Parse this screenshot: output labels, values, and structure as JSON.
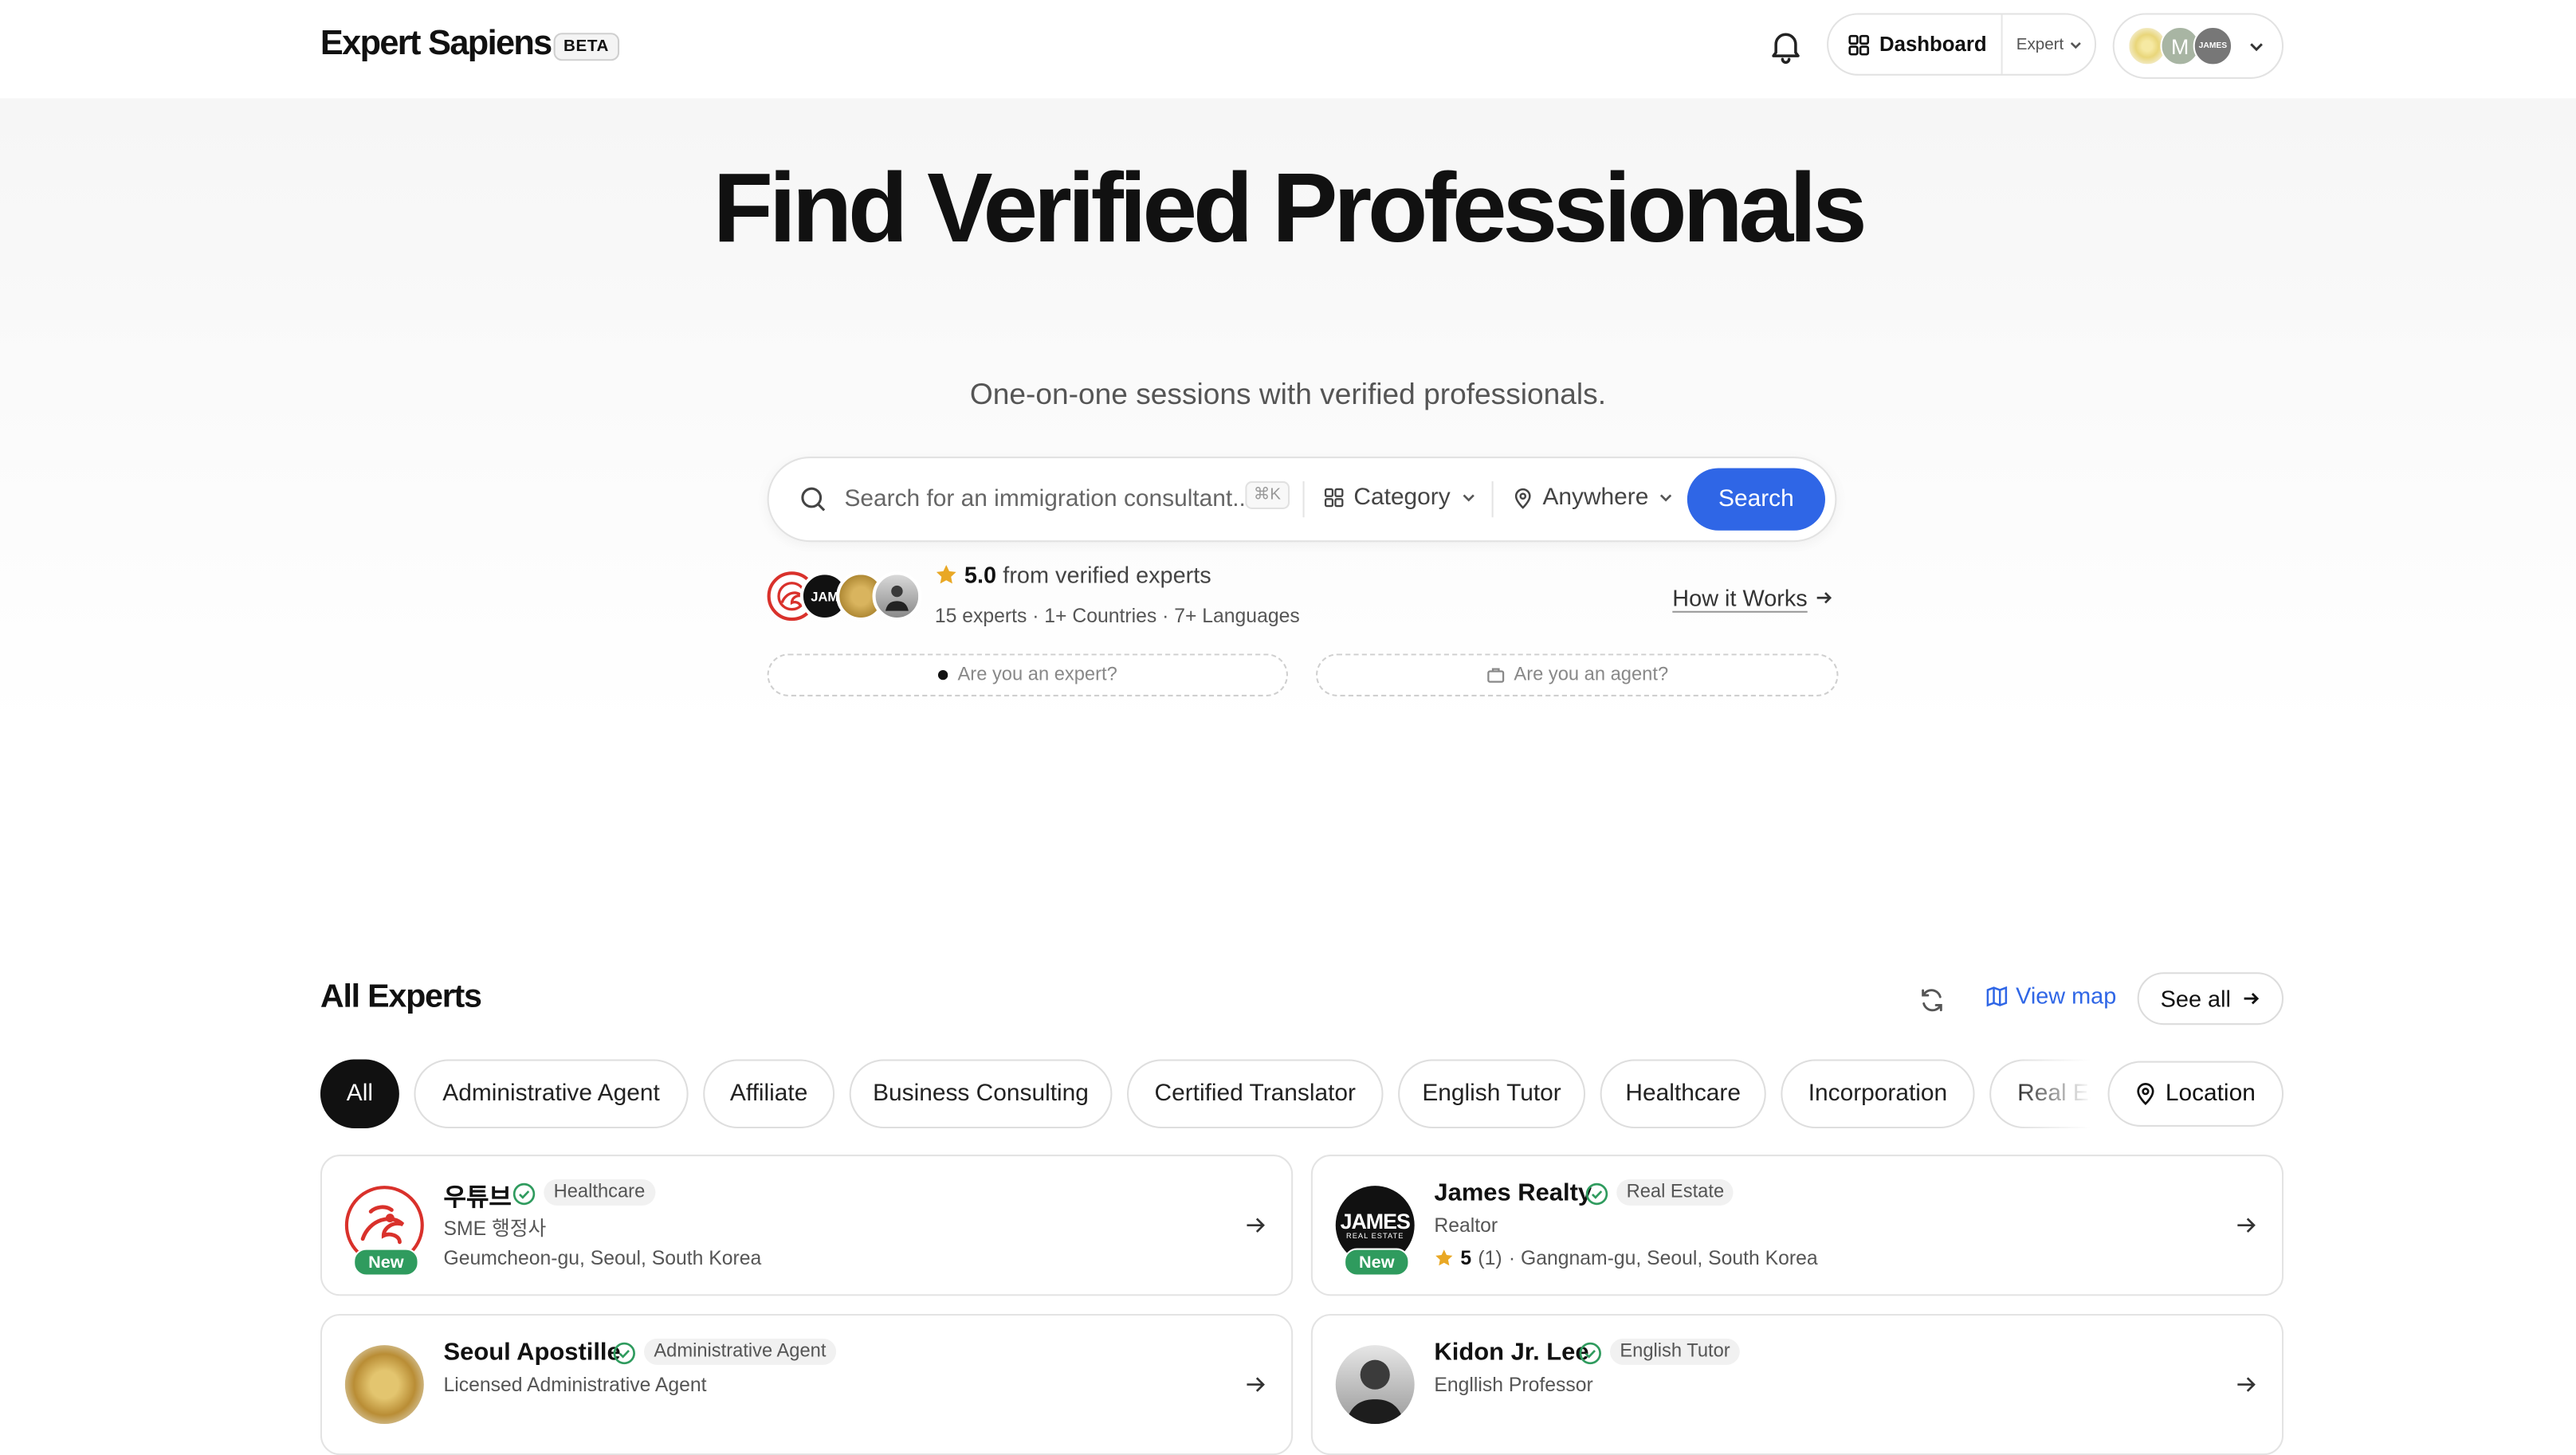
{
  "header": {
    "brand": "Expert Sapiens",
    "badge": "BETA",
    "dashboard_label": "Dashboard",
    "role_label": "Expert",
    "avatar_m": "M",
    "avatar_james": "JAMES"
  },
  "hero": {
    "title": "Find Verified Professionals",
    "subtitle": "One-on-one sessions with verified professionals.",
    "search_placeholder": "Search for an immigration consultant...",
    "shortcut": "⌘K",
    "category_label": "Category",
    "location_label": "Anywhere",
    "search_button": "Search",
    "rating_value": "5.0",
    "rating_text": "from verified experts",
    "stats": "15 experts · 1+ Countries · 7+ Languages",
    "how_it_works": "How it Works",
    "cta_expert": "Are you an expert?",
    "cta_agent": "Are you an agent?",
    "proof_james": "JAM"
  },
  "experts": {
    "title": "All Experts",
    "view_map": "View map",
    "see_all": "See all",
    "location_filter": "Location",
    "categories": [
      "All",
      "Administrative Agent",
      "Affiliate",
      "Business Consulting",
      "Certified Translator",
      "English Tutor",
      "Healthcare",
      "Incorporation",
      "Real Estate"
    ],
    "new_label": "New",
    "cards": [
      {
        "name": "우튜브",
        "tag": "Healthcare",
        "subtitle": "SME 행정사",
        "location": "Geumcheon-gu, Seoul, South Korea"
      },
      {
        "name": "James Realty",
        "tag": "Real Estate",
        "subtitle": "Realtor",
        "rating": "5",
        "reviews": "(1)",
        "location": "· Gangnam-gu, Seoul, South Korea",
        "logo_text": "JAMES",
        "logo_sub": "REAL ESTATE"
      },
      {
        "name": "Seoul Apostille",
        "tag": "Administrative Agent",
        "subtitle": "Licensed Administrative Agent"
      },
      {
        "name": "Kidon Jr. Lee",
        "tag": "English Tutor",
        "subtitle": "Engllish Professor"
      }
    ]
  },
  "colors": {
    "accent": "#2f66e6",
    "verified": "#2f9b5e",
    "star": "#e9a825",
    "new_badge": "#2f9b5e"
  },
  "icons": [
    "bell-icon",
    "grid-icon",
    "chevron-down-icon",
    "search-icon",
    "map-pin-icon",
    "star-icon",
    "arrow-right-icon",
    "refresh-icon",
    "map-icon",
    "verified-icon",
    "briefcase-icon",
    "dot-icon"
  ]
}
